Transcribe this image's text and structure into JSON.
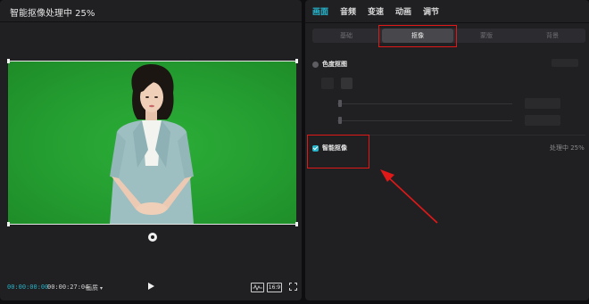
{
  "player": {
    "title": "智能抠像处理中 25%",
    "time_current": "00:00:00:00",
    "time_total": "00:00:27:04",
    "quality_label": "画质",
    "ratio_label": "16:9",
    "icons": [
      "play-icon",
      "waveform-icon",
      "fullscreen-icon",
      "rotate-handle-icon"
    ]
  },
  "tabs": [
    {
      "label": "画面",
      "active": true
    },
    {
      "label": "音频",
      "active": false
    },
    {
      "label": "变速",
      "active": false
    },
    {
      "label": "动画",
      "active": false
    },
    {
      "label": "调节",
      "active": false
    }
  ],
  "subtabs": [
    {
      "label": "基础",
      "active": false
    },
    {
      "label": "抠像",
      "active": true
    },
    {
      "label": "蒙版",
      "active": false
    },
    {
      "label": "背景",
      "active": false
    }
  ],
  "chroma": {
    "label": "色度抠图",
    "checked": false
  },
  "smart": {
    "label": "智能抠像",
    "checked": true,
    "status": "处理中 25%"
  },
  "colors": {
    "accent": "#27b7cf",
    "highlight": "#e01818",
    "green_screen": "#249d30"
  }
}
